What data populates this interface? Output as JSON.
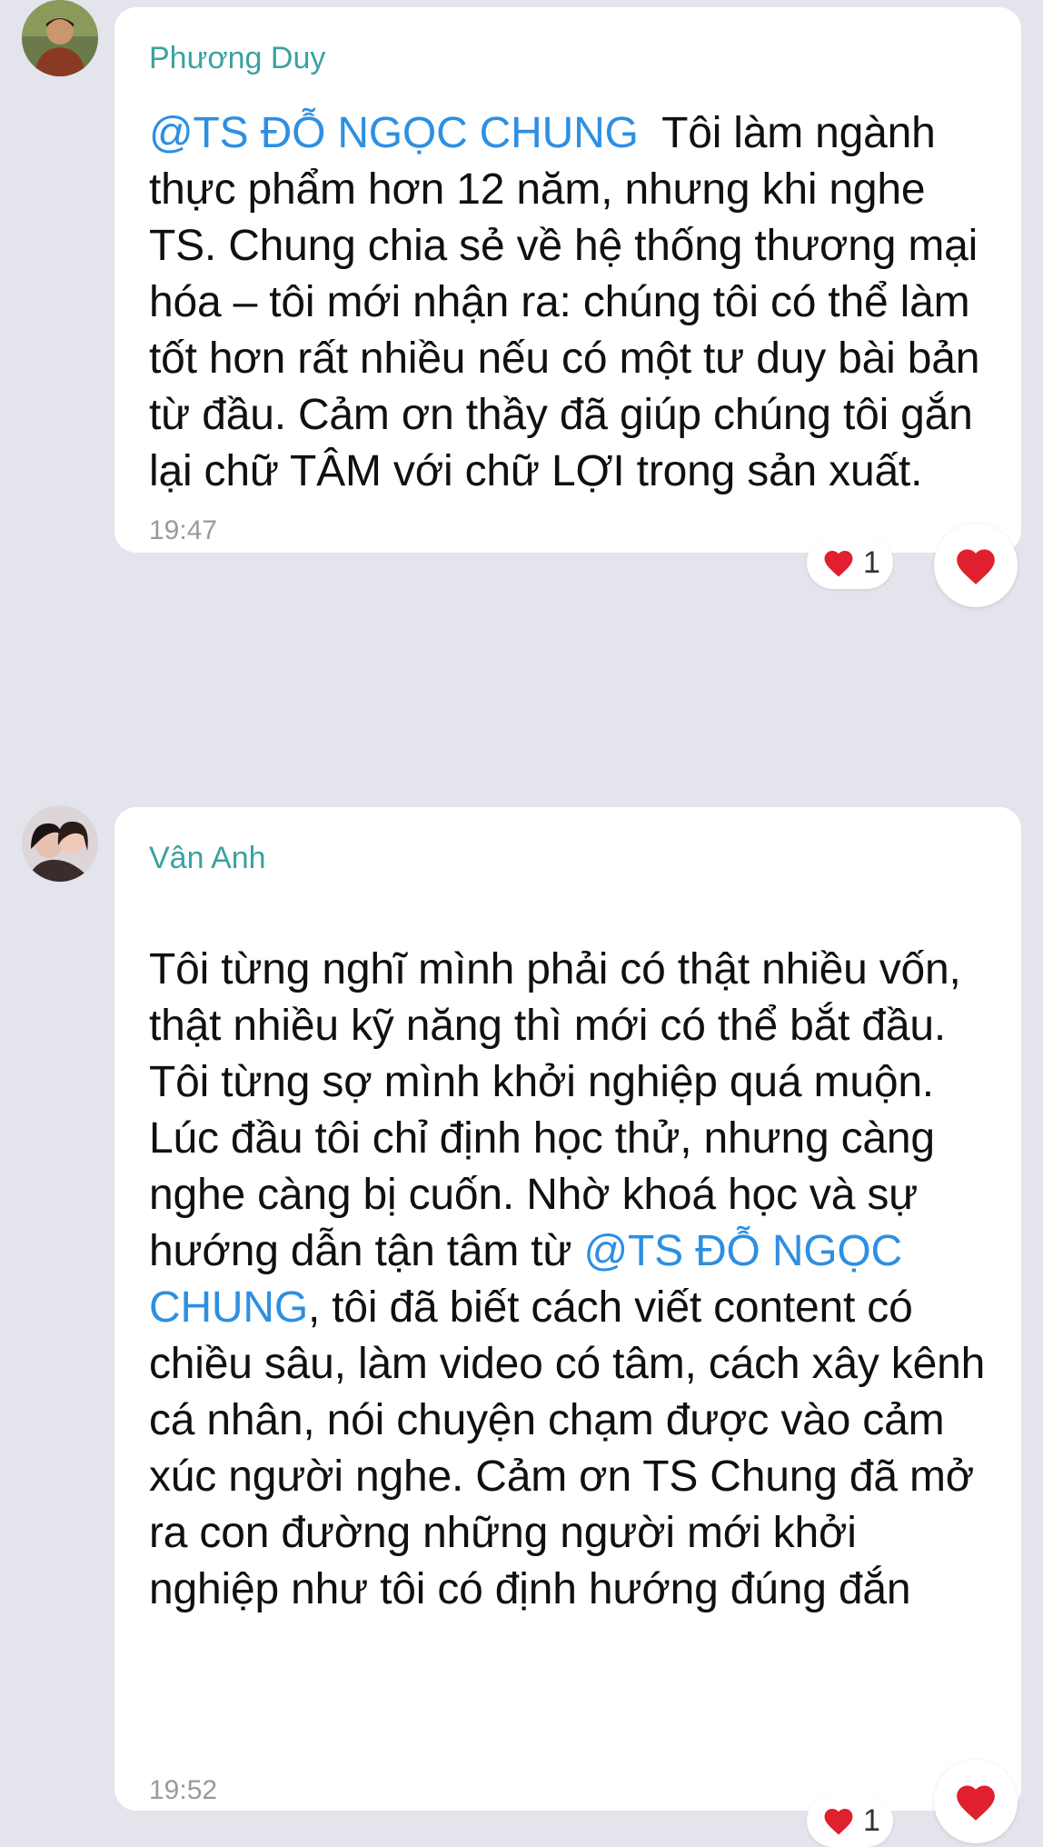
{
  "messages": [
    {
      "sender": "Phương Duy",
      "mention": "@TS ĐỖ NGỌC CHUNG",
      "text_after_mention": "  Tôi làm ngành thực phẩm hơn 12 năm, nhưng khi nghe TS. Chung chia sẻ về hệ thống thương mại hóa – tôi mới nhận ra: chúng tôi có thể làm tốt hơn rất nhiều nếu có một tư duy bài bản từ đầu. Cảm ơn thầy đã giúp chúng tôi gắn lại chữ TÂM với chữ LỢI trong sản xuất.",
      "time": "19:47",
      "reaction_count": "1",
      "reaction_icon": "heart-icon"
    },
    {
      "sender": "Vân Anh",
      "text_before_mention": "Tôi từng nghĩ mình phải có thật nhiều vốn, thật nhiều kỹ năng thì mới có thể bắt đầu. Tôi từng sợ mình khởi nghiệp quá muộn. Lúc đầu tôi chỉ định học thử, nhưng càng nghe càng bị cuốn. Nhờ khoá học và sự hướng dẫn tận tâm từ ",
      "mention": "@TS ĐỖ NGỌC CHUNG",
      "text_after_mention": ", tôi đã biết cách viết content có chiều sâu, làm video có tâm, cách xây kênh cá nhân, nói chuyện chạm được vào cảm xúc người nghe. Cảm ơn TS Chung đã mở ra con đường những người mới khởi nghiệp như tôi có định hướng đúng đắn",
      "time": "19:52",
      "reaction_count": "1",
      "reaction_icon": "heart-icon"
    }
  ],
  "colors": {
    "background": "#e3e4ec",
    "sender": "#3aa2a2",
    "mention": "#2d8fe2",
    "heart": "#e0202e"
  }
}
